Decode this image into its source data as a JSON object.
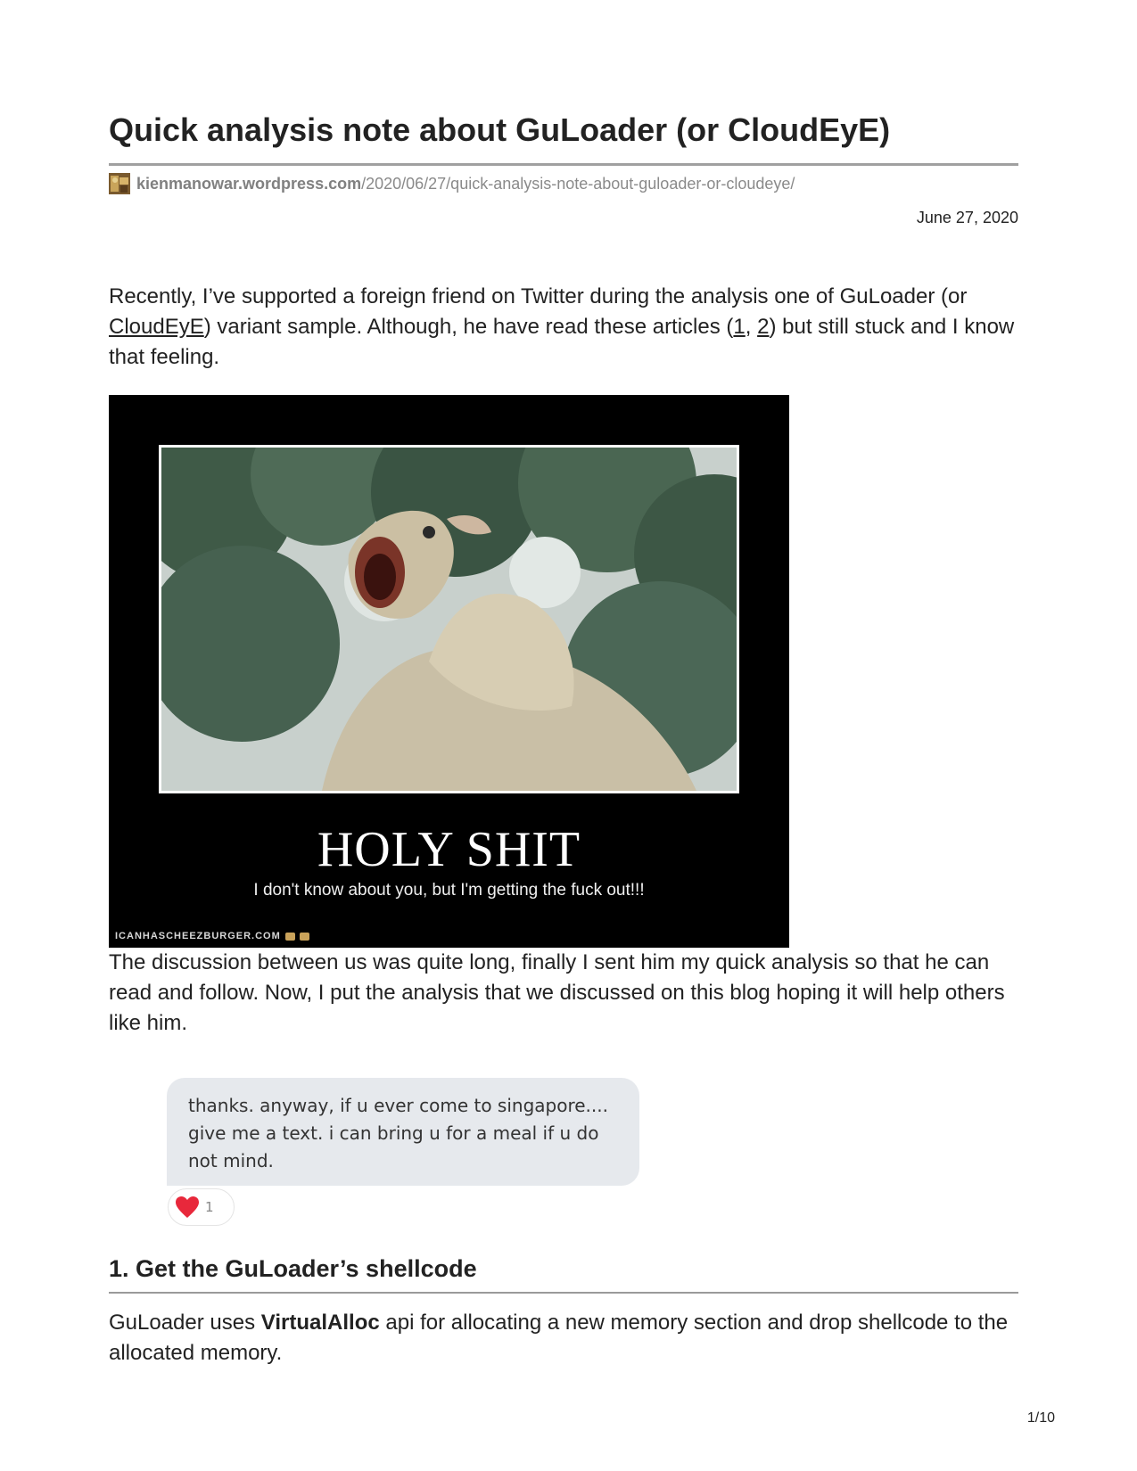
{
  "article": {
    "title": "Quick analysis note about GuLoader (or CloudEyE)",
    "source_domain": "kienmanowar.wordpress.com",
    "source_path": "/2020/06/27/quick-analysis-note-about-guloader-or-cloudeye/",
    "date": "June 27, 2020"
  },
  "intro": {
    "text_1": "Recently, I’ve supported a foreign friend on Twitter during the analysis one of GuLoader (or ",
    "link_cloudeye": "CloudEyE",
    "text_2": ") variant sample. Although, he have read these articles (",
    "link_1": "1",
    "sep": ", ",
    "link_2": "2",
    "text_3": ") but still stuck and I know that feeling."
  },
  "meme": {
    "heading": "HOLY SHIT",
    "caption": "I don't know about you, but I'm getting the fuck out!!!",
    "watermark": "ICANHASCHEEZBURGER.COM"
  },
  "discussion": {
    "text": "The discussion between us was quite long, finally I sent him my quick analysis so that he can read and follow. Now, I put the analysis that we discussed on this blog hoping it will help others like him."
  },
  "chat": {
    "message": "thanks. anyway, if u ever come to singapore.... give me a text. i can bring u for a meal if u do not mind.",
    "reaction_count": "1",
    "reaction_icon": "heart-icon",
    "reaction_color": "#e8283b",
    "bubble_color": "#e6e9ed"
  },
  "section_1": {
    "heading": "1. Get the GuLoader’s shellcode",
    "text_before": "GuLoader uses ",
    "bold_term": "VirtualAlloc",
    "text_after": " api for allocating a new memory section and drop shellcode to the allocated memory."
  },
  "footer": {
    "page_number": "1/10"
  }
}
